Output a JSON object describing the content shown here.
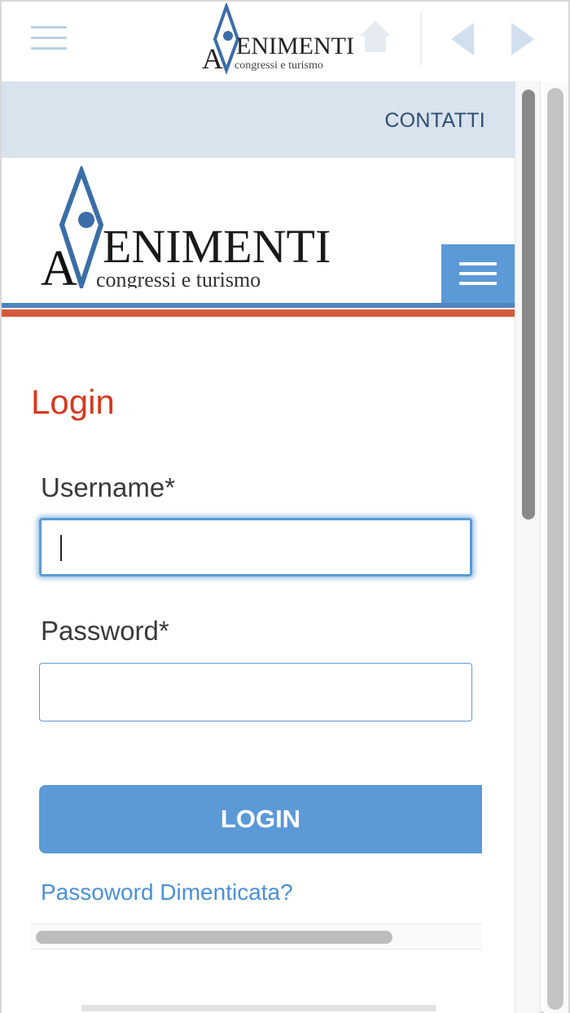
{
  "toolbar": {
    "logo": {
      "wordmark": "ENIMENTI",
      "tagline": "congressi e turismo"
    }
  },
  "header": {
    "contact_link": "CONTATTI",
    "logo": {
      "wordmark": "ENIMENTI",
      "tagline": "congressi e turismo"
    }
  },
  "login_form": {
    "title": "Login",
    "username_label": "Username*",
    "username_value": "",
    "password_label": "Password*",
    "password_value": "",
    "submit_label": "LOGIN",
    "forgot_link": "Passoword Dimenticata?"
  },
  "icons": {
    "menu": "hamburger-menu-icon",
    "home": "home-icon",
    "back": "back-arrow-icon",
    "forward": "forward-arrow-icon",
    "nav_toggle": "hamburger-menu-icon"
  },
  "colors": {
    "accent_blue": "#5b9ad6",
    "title_red": "#d63a1f",
    "contact_bar": "#d9e3ee",
    "contact_text": "#2d4f73",
    "stripe_red": "#d45a3c",
    "stripe_blue": "#4f84c0"
  }
}
